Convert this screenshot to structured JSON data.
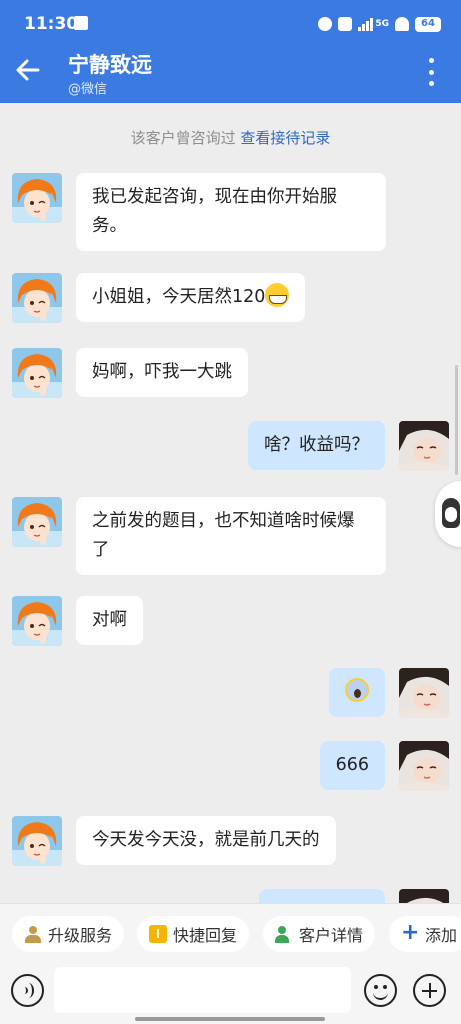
{
  "status_bar": {
    "time": "11:30",
    "network": "5G",
    "battery": "64"
  },
  "header": {
    "title": "宁静致远",
    "subtitle": "@微信"
  },
  "system_note": {
    "text": "该客户曾咨询过",
    "link": "查看接待记录"
  },
  "messages": [
    {
      "from": "customer",
      "text": "我已发起咨询，现在由你开始服务。"
    },
    {
      "from": "customer",
      "text": "小姐姐，今天居然120",
      "emoji": "grinning-face"
    },
    {
      "from": "customer",
      "text": "妈啊，吓我一大跳"
    },
    {
      "from": "agent",
      "text": "啥？收益吗？"
    },
    {
      "from": "customer",
      "text": "之前发的题目，也不知道啥时候爆了"
    },
    {
      "from": "customer",
      "text": "对啊"
    },
    {
      "from": "agent",
      "text": "",
      "emoji": "screaming-face"
    },
    {
      "from": "agent",
      "text": "666"
    },
    {
      "from": "customer",
      "text": "今天发今天没，就是前几天的"
    },
    {
      "from": "agent",
      "text": ""
    }
  ],
  "quick_actions": [
    {
      "label": "升级服务",
      "icon": "upgrade-icon"
    },
    {
      "label": "快捷回复",
      "icon": "quick-reply-icon"
    },
    {
      "label": "客户详情",
      "icon": "customer-detail-icon"
    },
    {
      "label": "添加",
      "icon": "plus-icon"
    }
  ],
  "colors": {
    "header": "#3b7ae0",
    "agent_bubble": "#cfe6ff",
    "link": "#2f69c8",
    "background": "#ededed"
  }
}
